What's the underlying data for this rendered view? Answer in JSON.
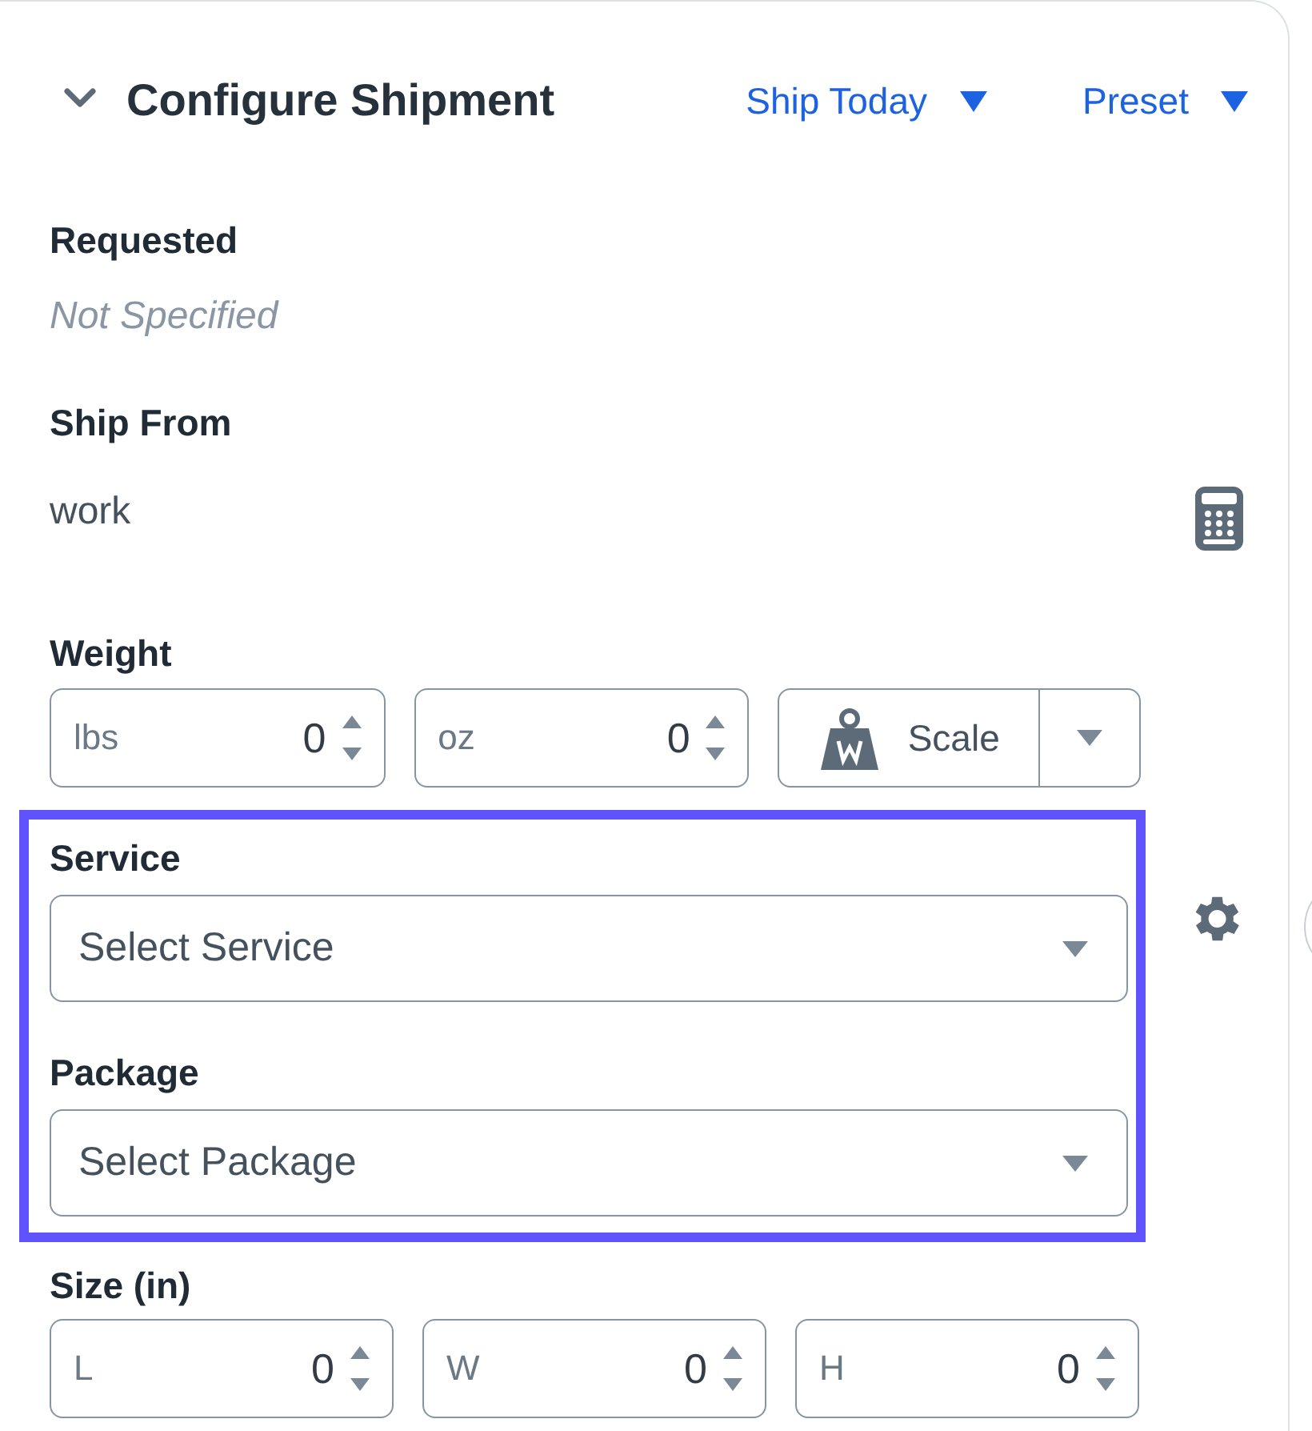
{
  "header": {
    "title": "Configure Shipment",
    "expanded": true,
    "menus": [
      "Ship Today",
      "Preset"
    ]
  },
  "requested": {
    "label": "Requested",
    "value": "Not Specified"
  },
  "ship_from": {
    "label": "Ship From",
    "value": "work"
  },
  "weight": {
    "label": "Weight",
    "fields": [
      {
        "unit": "lbs",
        "value": "0"
      },
      {
        "unit": "oz",
        "value": "0"
      }
    ],
    "scale_button": "Scale"
  },
  "service": {
    "label": "Service",
    "placeholder": "Select Service"
  },
  "package": {
    "label": "Package",
    "placeholder": "Select Package"
  },
  "size": {
    "label": "Size (in)",
    "fields": [
      {
        "unit": "L",
        "value": "0"
      },
      {
        "unit": "W",
        "value": "0"
      },
      {
        "unit": "H",
        "value": "0"
      }
    ]
  }
}
